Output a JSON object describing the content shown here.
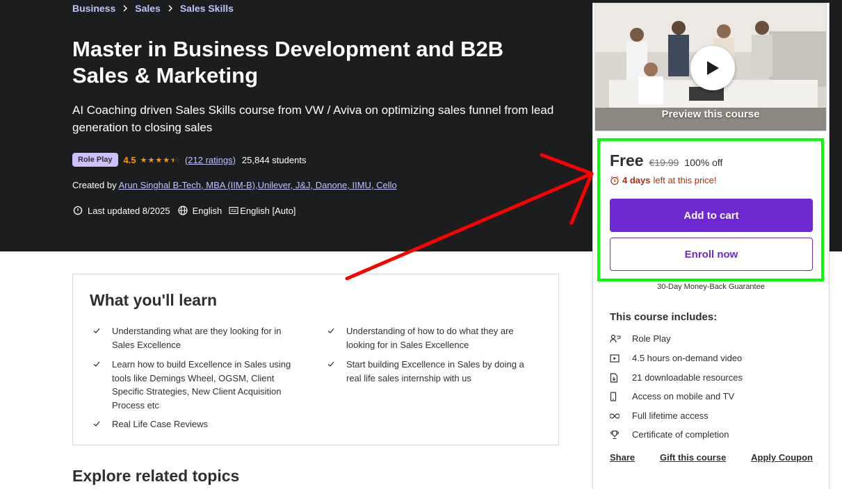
{
  "breadcrumb": [
    "Business",
    "Sales",
    "Sales Skills"
  ],
  "course": {
    "title": "Master in Business Development and B2B Sales & Marketing",
    "subtitle": "AI Coaching driven Sales Skills course from VW / Aviva on optimizing sales funnel from lead generation to closing sales",
    "badge": "Role Play",
    "rating": "4.5",
    "rating_stars": 4.5,
    "ratings_count": "(212 ratings)",
    "students": "25,844 students",
    "created_by_label": "Created by",
    "author": "Arun Singhal B-Tech, MBA (IIM-B),Unilever, J&J, Danone, IIMU, Cello",
    "last_updated": "Last updated 8/2025",
    "language": "English",
    "captions": "English [Auto]"
  },
  "learn": {
    "title": "What you'll learn",
    "items": [
      "Understanding what are they looking for in Sales Excellence",
      "Understanding of how to do what they are looking for in Sales Excellence",
      "Learn how to build Excellence in Sales using tools like Demings Wheel, OGSM, Client Specific Strategies, New Client Acquisition Process etc",
      "Start building Excellence in Sales by doing a real life sales internship with us",
      "Real Life Case Reviews"
    ]
  },
  "explore_title": "Explore related topics",
  "sidebar": {
    "preview_label": "Preview this course",
    "price": "Free",
    "original_price": "€19.99",
    "discount": "100% off",
    "timer_bold": "4 days",
    "timer_rest": "left at this price!",
    "add_to_cart": "Add to cart",
    "enroll_now": "Enroll now",
    "guarantee": "30-Day Money-Back Guarantee",
    "includes_title": "This course includes:",
    "includes": [
      {
        "icon": "role-play-icon",
        "label": "Role Play"
      },
      {
        "icon": "video-icon",
        "label": "4.5 hours on-demand video"
      },
      {
        "icon": "download-icon",
        "label": "21 downloadable resources"
      },
      {
        "icon": "mobile-icon",
        "label": "Access on mobile and TV"
      },
      {
        "icon": "infinity-icon",
        "label": "Full lifetime access"
      },
      {
        "icon": "trophy-icon",
        "label": "Certificate of completion"
      }
    ],
    "share": "Share",
    "gift": "Gift this course",
    "coupon": "Apply Coupon"
  },
  "colors": {
    "hero_bg": "#1c1d1f",
    "accent": "#6d28d2",
    "link": "#c0c4fc",
    "star": "#f69c08",
    "timer": "#b32d0f",
    "highlight": "#00ff00",
    "arrow": "#ff0000"
  }
}
